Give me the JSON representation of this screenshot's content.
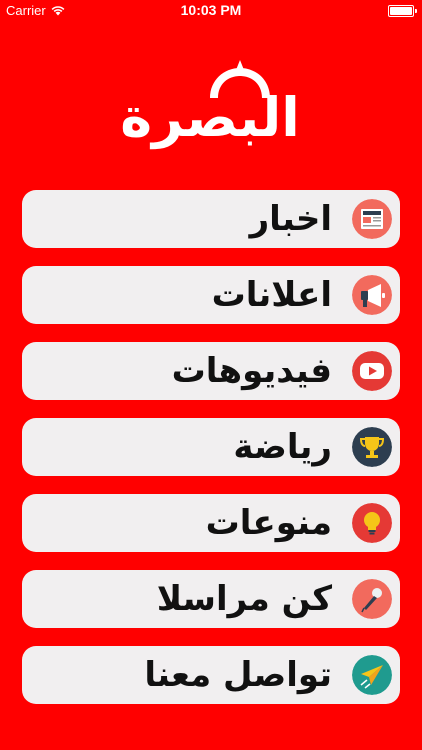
{
  "status_bar": {
    "carrier": "Carrier",
    "time": "10:03 PM"
  },
  "logo": {
    "text": "البصرة"
  },
  "menu": {
    "items": [
      {
        "label": "اخبار",
        "icon": "news-icon",
        "icon_color": "#f26a5d"
      },
      {
        "label": "اعلانات",
        "icon": "megaphone-icon",
        "icon_color": "#f26a5d"
      },
      {
        "label": "فيديوهات",
        "icon": "youtube-icon",
        "icon_color": "#e53935"
      },
      {
        "label": "رياضة",
        "icon": "trophy-icon",
        "icon_color": "#2d3e50"
      },
      {
        "label": "منوعات",
        "icon": "lightbulb-icon",
        "icon_color": "#e53935"
      },
      {
        "label": "كن مراسلا",
        "icon": "microphone-icon",
        "icon_color": "#f26a5d"
      },
      {
        "label": "تواصل معنا",
        "icon": "paper-plane-icon",
        "icon_color": "#1f9b8f"
      }
    ]
  }
}
